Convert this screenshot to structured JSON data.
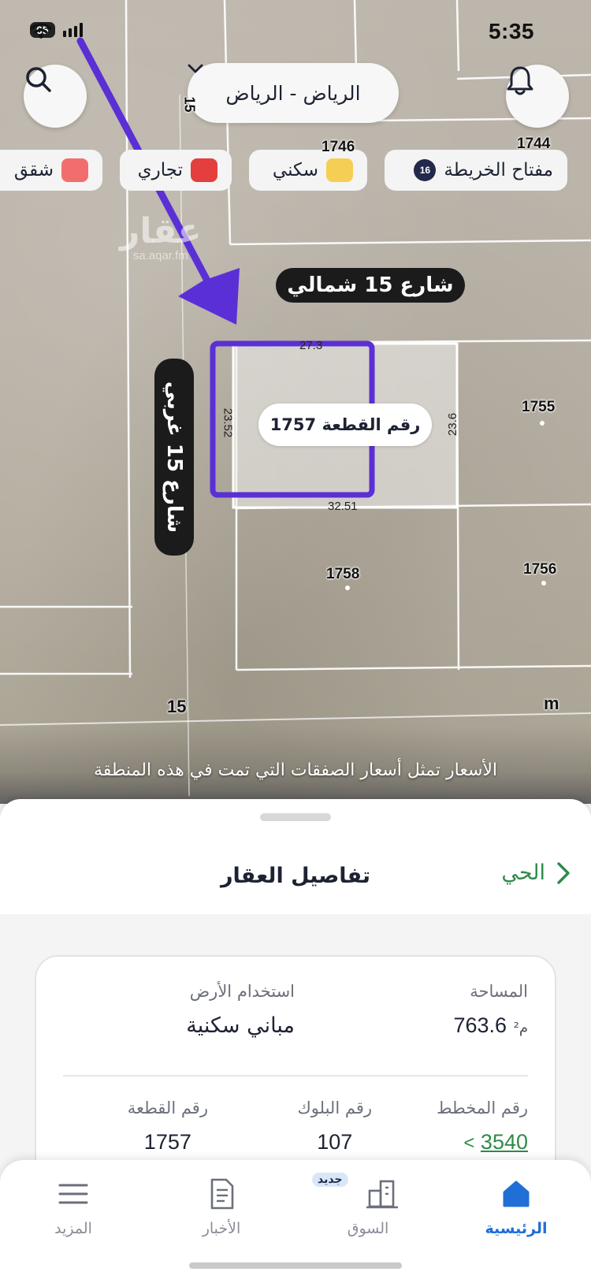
{
  "status_bar": {
    "time": "5:35",
    "battery": "65"
  },
  "header": {
    "city": "الرياض - الرياض",
    "search_icon": "search-icon",
    "notification_icon": "bell-icon"
  },
  "filters": [
    {
      "label": "مفتاح الخريطة",
      "badge": "16"
    },
    {
      "label": "سكني",
      "color": "#f5cf53"
    },
    {
      "label": "تجاري",
      "color": "#e53e3e"
    },
    {
      "label": "شقق",
      "color": "#f26e6e"
    }
  ],
  "map": {
    "watermark": {
      "brand": "عقار",
      "domain": "sa.aqar.fm"
    },
    "streets": {
      "north": "شارع 15 شمالي",
      "west": "شارع 15 غربي",
      "bottom": "15",
      "corner_top": "15"
    },
    "plots": {
      "p1746": "1746",
      "p1744": "1744",
      "p1755": "1755",
      "p1758": "1758",
      "p1756": "1756"
    },
    "selected_plot": {
      "label": "رقم القطعة 1757",
      "left_dim": "23.52",
      "right_dim": "23.6",
      "bottom_dim": "32.51",
      "top_dim": "27.3"
    },
    "misc_letter": "m",
    "notice": "الأسعار تمثل أسعار الصفقات التي تمت في هذه المنطقة",
    "accent_color": "#5b2fd6"
  },
  "sheet": {
    "title": "تفاصيل العقار",
    "neighborhood_link": "الحي",
    "area": {
      "label": "المساحة",
      "value": "763.6",
      "unit": "م²"
    },
    "land_use": {
      "label": "استخدام الأرض",
      "value": "مباني سكنية"
    },
    "plan_number": {
      "label": "رقم المخطط",
      "value": "3540"
    },
    "block_number": {
      "label": "رقم البلوك",
      "value": "107"
    },
    "plot_number": {
      "label": "رقم القطعة",
      "value": "1757"
    }
  },
  "tabs": [
    {
      "label": "الرئيسية",
      "icon": "home-icon",
      "active": true
    },
    {
      "label": "السوق",
      "icon": "buildings-icon",
      "badge": "جديد"
    },
    {
      "label": "الأخبار",
      "icon": "news-icon"
    },
    {
      "label": "المزيد",
      "icon": "menu-icon"
    }
  ],
  "colors": {
    "primary": "#1f6fd6",
    "link_green": "#2f8a4a",
    "dark": "#1d2233"
  }
}
